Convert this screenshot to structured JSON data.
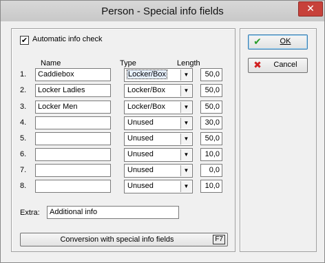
{
  "window": {
    "title": "Person - Special info fields",
    "close_glyph": "✕"
  },
  "auto_check": {
    "label": "Automatic info check",
    "checked": true,
    "check_glyph": "✔"
  },
  "headers": {
    "name": "Name",
    "type": "Type",
    "length": "Length"
  },
  "rows": [
    {
      "num": "1.",
      "name": "Caddiebox",
      "type": "Locker/Box",
      "length": "50,0"
    },
    {
      "num": "2.",
      "name": "Locker Ladies",
      "type": "Locker/Box",
      "length": "50,0"
    },
    {
      "num": "3.",
      "name": "Locker Men",
      "type": "Locker/Box",
      "length": "50,0"
    },
    {
      "num": "4.",
      "name": "",
      "type": "Unused",
      "length": "30,0"
    },
    {
      "num": "5.",
      "name": "",
      "type": "Unused",
      "length": "50,0"
    },
    {
      "num": "6.",
      "name": "",
      "type": "Unused",
      "length": "10,0"
    },
    {
      "num": "7.",
      "name": "",
      "type": "Unused",
      "length": "0,0"
    },
    {
      "num": "8.",
      "name": "",
      "type": "Unused",
      "length": "10,0"
    }
  ],
  "extra": {
    "label": "Extra:",
    "value": "Additional info"
  },
  "buttons": {
    "ok": "OK",
    "cancel": "Cancel",
    "conversion": "Conversion with special info fields",
    "conversion_key": "F7"
  },
  "colors": {
    "ok_icon": "#2a9d2a",
    "cancel_icon": "#d02020"
  }
}
